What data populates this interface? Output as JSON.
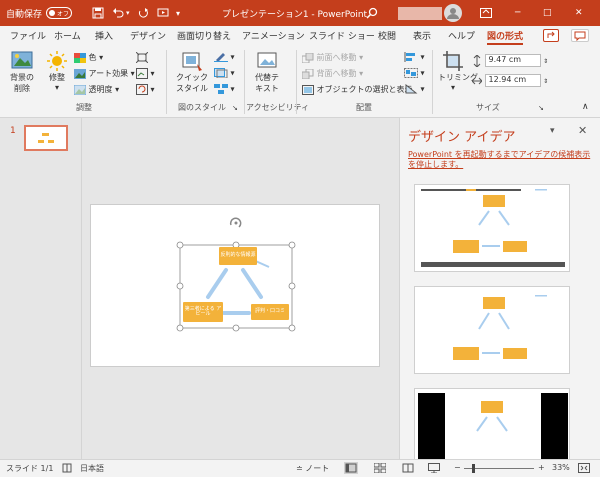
{
  "titlebar": {
    "autosave_label": "自動保存",
    "autosave_state": "オフ",
    "title": "プレゼンテーション1  -  PowerPoint",
    "minimize": "─",
    "restore": "□",
    "close": "✕"
  },
  "tabs": [
    "ファイル",
    "ホーム",
    "挿入",
    "デザイン",
    "画面切り替え",
    "アニメーション",
    "スライド ショー",
    "校閲",
    "表示",
    "ヘルプ",
    "図の形式"
  ],
  "active_tab": "図の形式",
  "ribbon": {
    "remove_bg": [
      "背景の",
      "削除"
    ],
    "corrections": "修整",
    "color": "色",
    "artistic": "アート効果",
    "transparency": "透明度",
    "group_adjust": "調整",
    "quick_styles": [
      "クイック",
      "スタイル"
    ],
    "group_styles": "図のスタイル",
    "alt_text": [
      "代替テ",
      "キスト"
    ],
    "group_access": "アクセシビリティ",
    "bring_forward": "前面へ移動",
    "send_backward": "背面へ移動",
    "selection_pane": "オブジェクトの選択と表示",
    "group_arrange": "配置",
    "crop": "トリミング",
    "height": "9.47 cm",
    "width": "12.94 cm",
    "group_size": "サイズ"
  },
  "slides_pane": {
    "slide_number": "1"
  },
  "diagram": {
    "top_node": "反則的な情報源",
    "left_node": "第三者による アピール",
    "right_node": "評判・口コミ"
  },
  "design_pane": {
    "title": "デザイン アイデア",
    "message": "PowerPoint を再起動するまでアイデアの候補表示を停止します。"
  },
  "statusbar": {
    "slide_info": "スライド 1/1",
    "language": "日本語",
    "notes": "ノート",
    "zoom": "33%"
  },
  "colors": {
    "accent": "#c43e1c",
    "node": "#f3b23a",
    "arrow": "#a9cdee"
  }
}
